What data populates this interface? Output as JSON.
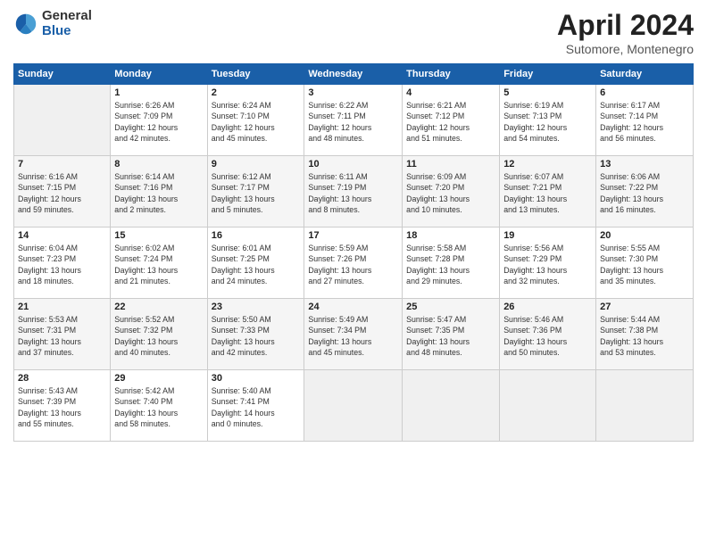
{
  "header": {
    "logo_general": "General",
    "logo_blue": "Blue",
    "title": "April 2024",
    "location": "Sutomore, Montenegro"
  },
  "calendar": {
    "days_of_week": [
      "Sunday",
      "Monday",
      "Tuesday",
      "Wednesday",
      "Thursday",
      "Friday",
      "Saturday"
    ],
    "weeks": [
      [
        {
          "day": "",
          "info": ""
        },
        {
          "day": "1",
          "info": "Sunrise: 6:26 AM\nSunset: 7:09 PM\nDaylight: 12 hours\nand 42 minutes."
        },
        {
          "day": "2",
          "info": "Sunrise: 6:24 AM\nSunset: 7:10 PM\nDaylight: 12 hours\nand 45 minutes."
        },
        {
          "day": "3",
          "info": "Sunrise: 6:22 AM\nSunset: 7:11 PM\nDaylight: 12 hours\nand 48 minutes."
        },
        {
          "day": "4",
          "info": "Sunrise: 6:21 AM\nSunset: 7:12 PM\nDaylight: 12 hours\nand 51 minutes."
        },
        {
          "day": "5",
          "info": "Sunrise: 6:19 AM\nSunset: 7:13 PM\nDaylight: 12 hours\nand 54 minutes."
        },
        {
          "day": "6",
          "info": "Sunrise: 6:17 AM\nSunset: 7:14 PM\nDaylight: 12 hours\nand 56 minutes."
        }
      ],
      [
        {
          "day": "7",
          "info": "Sunrise: 6:16 AM\nSunset: 7:15 PM\nDaylight: 12 hours\nand 59 minutes."
        },
        {
          "day": "8",
          "info": "Sunrise: 6:14 AM\nSunset: 7:16 PM\nDaylight: 13 hours\nand 2 minutes."
        },
        {
          "day": "9",
          "info": "Sunrise: 6:12 AM\nSunset: 7:17 PM\nDaylight: 13 hours\nand 5 minutes."
        },
        {
          "day": "10",
          "info": "Sunrise: 6:11 AM\nSunset: 7:19 PM\nDaylight: 13 hours\nand 8 minutes."
        },
        {
          "day": "11",
          "info": "Sunrise: 6:09 AM\nSunset: 7:20 PM\nDaylight: 13 hours\nand 10 minutes."
        },
        {
          "day": "12",
          "info": "Sunrise: 6:07 AM\nSunset: 7:21 PM\nDaylight: 13 hours\nand 13 minutes."
        },
        {
          "day": "13",
          "info": "Sunrise: 6:06 AM\nSunset: 7:22 PM\nDaylight: 13 hours\nand 16 minutes."
        }
      ],
      [
        {
          "day": "14",
          "info": "Sunrise: 6:04 AM\nSunset: 7:23 PM\nDaylight: 13 hours\nand 18 minutes."
        },
        {
          "day": "15",
          "info": "Sunrise: 6:02 AM\nSunset: 7:24 PM\nDaylight: 13 hours\nand 21 minutes."
        },
        {
          "day": "16",
          "info": "Sunrise: 6:01 AM\nSunset: 7:25 PM\nDaylight: 13 hours\nand 24 minutes."
        },
        {
          "day": "17",
          "info": "Sunrise: 5:59 AM\nSunset: 7:26 PM\nDaylight: 13 hours\nand 27 minutes."
        },
        {
          "day": "18",
          "info": "Sunrise: 5:58 AM\nSunset: 7:28 PM\nDaylight: 13 hours\nand 29 minutes."
        },
        {
          "day": "19",
          "info": "Sunrise: 5:56 AM\nSunset: 7:29 PM\nDaylight: 13 hours\nand 32 minutes."
        },
        {
          "day": "20",
          "info": "Sunrise: 5:55 AM\nSunset: 7:30 PM\nDaylight: 13 hours\nand 35 minutes."
        }
      ],
      [
        {
          "day": "21",
          "info": "Sunrise: 5:53 AM\nSunset: 7:31 PM\nDaylight: 13 hours\nand 37 minutes."
        },
        {
          "day": "22",
          "info": "Sunrise: 5:52 AM\nSunset: 7:32 PM\nDaylight: 13 hours\nand 40 minutes."
        },
        {
          "day": "23",
          "info": "Sunrise: 5:50 AM\nSunset: 7:33 PM\nDaylight: 13 hours\nand 42 minutes."
        },
        {
          "day": "24",
          "info": "Sunrise: 5:49 AM\nSunset: 7:34 PM\nDaylight: 13 hours\nand 45 minutes."
        },
        {
          "day": "25",
          "info": "Sunrise: 5:47 AM\nSunset: 7:35 PM\nDaylight: 13 hours\nand 48 minutes."
        },
        {
          "day": "26",
          "info": "Sunrise: 5:46 AM\nSunset: 7:36 PM\nDaylight: 13 hours\nand 50 minutes."
        },
        {
          "day": "27",
          "info": "Sunrise: 5:44 AM\nSunset: 7:38 PM\nDaylight: 13 hours\nand 53 minutes."
        }
      ],
      [
        {
          "day": "28",
          "info": "Sunrise: 5:43 AM\nSunset: 7:39 PM\nDaylight: 13 hours\nand 55 minutes."
        },
        {
          "day": "29",
          "info": "Sunrise: 5:42 AM\nSunset: 7:40 PM\nDaylight: 13 hours\nand 58 minutes."
        },
        {
          "day": "30",
          "info": "Sunrise: 5:40 AM\nSunset: 7:41 PM\nDaylight: 14 hours\nand 0 minutes."
        },
        {
          "day": "",
          "info": ""
        },
        {
          "day": "",
          "info": ""
        },
        {
          "day": "",
          "info": ""
        },
        {
          "day": "",
          "info": ""
        }
      ]
    ]
  }
}
